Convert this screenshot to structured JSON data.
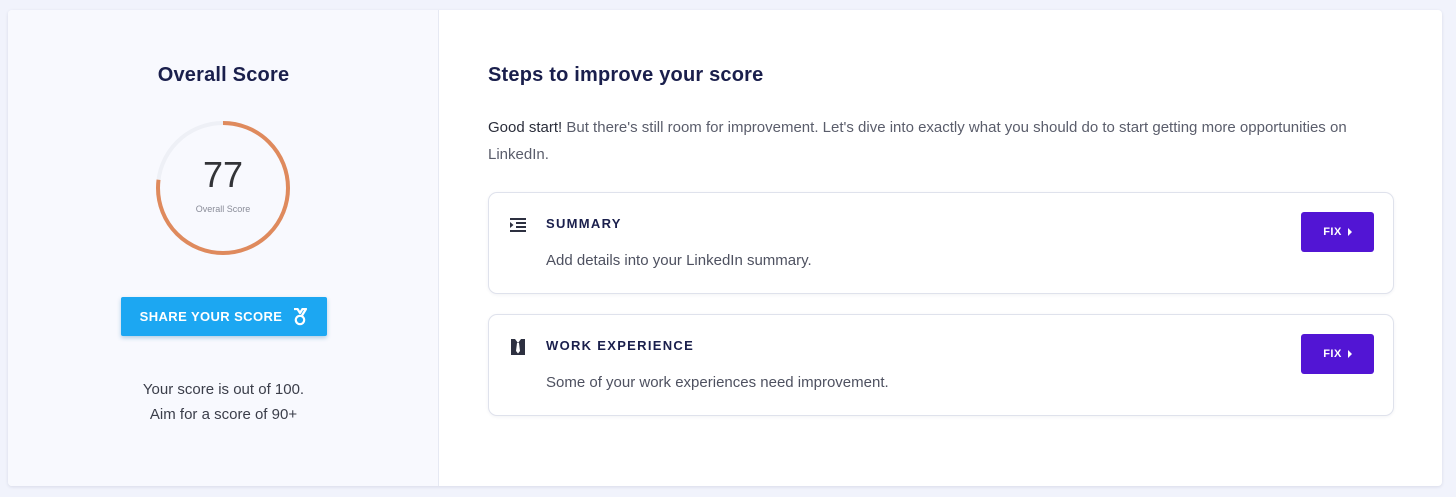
{
  "overall": {
    "title": "Overall Score",
    "score": "77",
    "score_value": 77,
    "score_max": 100,
    "score_caption": "Overall Score",
    "share_label": "SHARE YOUR SCORE",
    "share_icon": "medal-icon",
    "note_line1": "Your score is out of 100.",
    "note_line2": "Aim for a score of 90+",
    "gauge_color": "#df8a5d",
    "gauge_track_color": "#eef0f6"
  },
  "steps": {
    "title": "Steps to improve your score",
    "intro_lead": "Good start!",
    "intro_rest": " But there's still room for improvement. Let's dive into exactly what you should do to start getting more opportunities on LinkedIn.",
    "items": [
      {
        "icon": "indent-list-icon",
        "title": "SUMMARY",
        "description": "Add details into your LinkedIn summary.",
        "action_label": "FIX"
      },
      {
        "icon": "suit-tie-icon",
        "title": "WORK EXPERIENCE",
        "description": "Some of your work experiences need improvement.",
        "action_label": "FIX"
      }
    ]
  },
  "colors": {
    "accent_blue": "#1ca7f2",
    "accent_purple": "#5215d4",
    "heading": "#1a1f4c"
  }
}
